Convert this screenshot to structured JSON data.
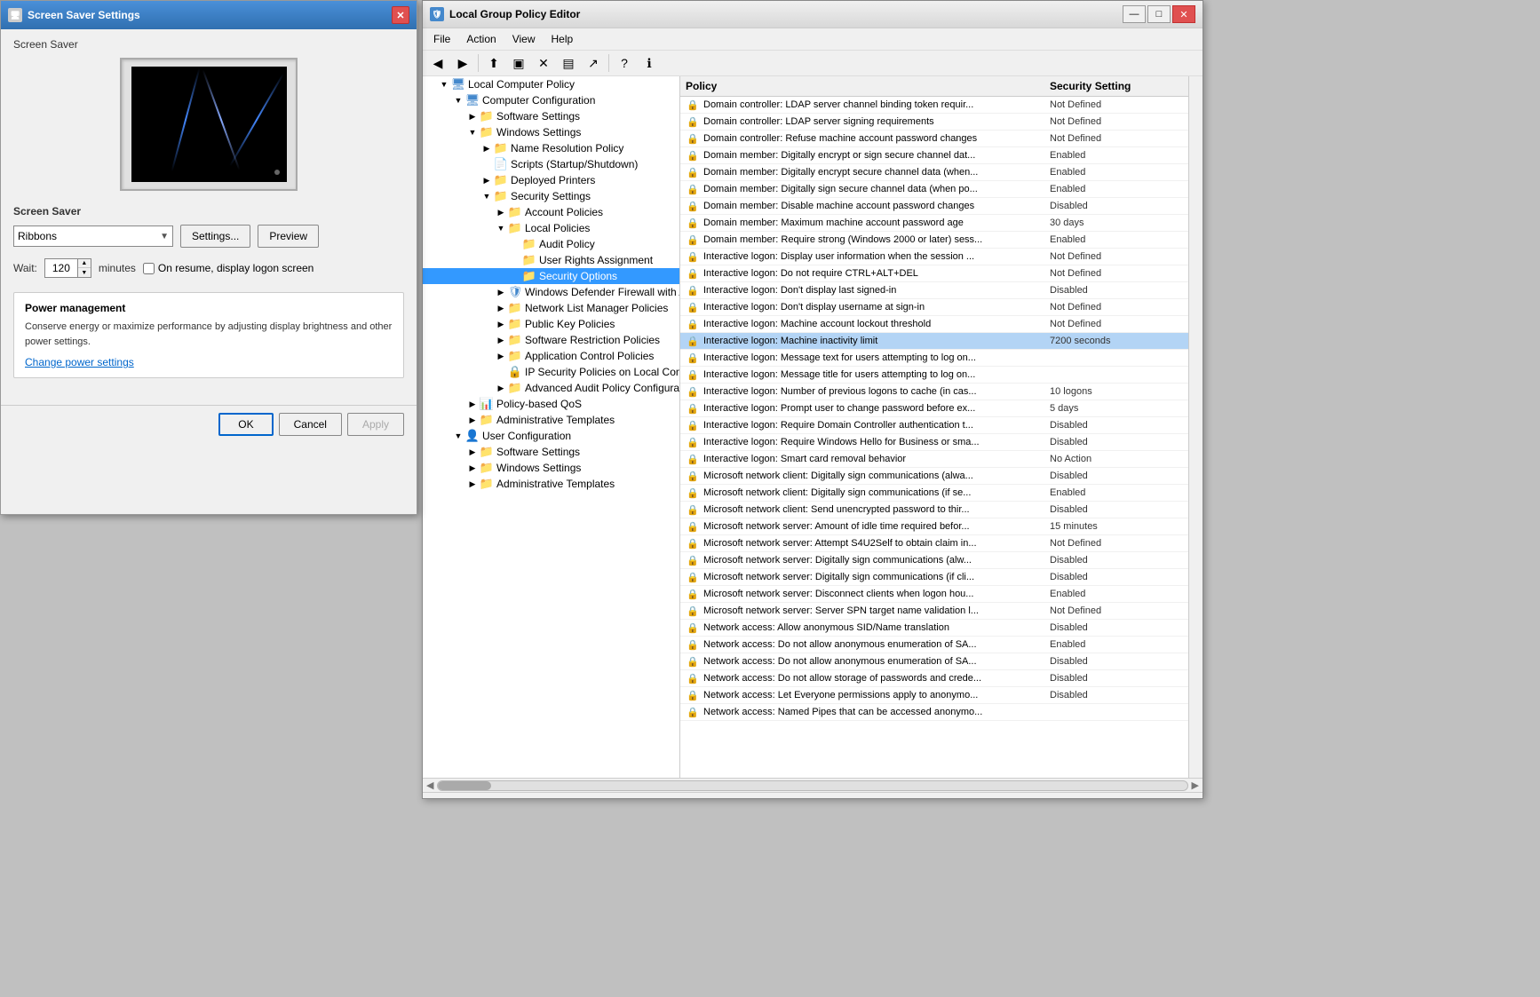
{
  "screensaver_dialog": {
    "title": "Screen Saver Settings",
    "section_label": "Screen Saver",
    "screensaver_name": "Ribbons",
    "settings_btn": "Settings...",
    "preview_btn": "Preview",
    "wait_label": "Wait:",
    "wait_value": "120",
    "minutes_label": "minutes",
    "resume_label": "On resume, display logon screen",
    "power_title": "Power management",
    "power_text": "Conserve energy or maximize performance by adjusting display brightness and other power settings.",
    "power_link": "Change power settings",
    "ok_btn": "OK",
    "cancel_btn": "Cancel",
    "apply_btn": "Apply"
  },
  "gpo_window": {
    "title": "Local Group Policy Editor",
    "menu": {
      "file": "File",
      "action": "Action",
      "view": "View",
      "help": "Help"
    },
    "tree": {
      "root": "Local Computer Policy",
      "computer_config": "Computer Configuration",
      "software_settings": "Software Settings",
      "windows_settings": "Windows Settings",
      "name_resolution": "Name Resolution Policy",
      "scripts": "Scripts (Startup/Shutdown)",
      "deployed_printers": "Deployed Printers",
      "security_settings": "Security Settings",
      "account_policies": "Account Policies",
      "local_policies": "Local Policies",
      "audit_policy": "Audit Policy",
      "user_rights": "User Rights Assignment",
      "security_options": "Security Options",
      "windows_firewall": "Windows Defender Firewall with Adv...",
      "network_list": "Network List Manager Policies",
      "public_key": "Public Key Policies",
      "software_restriction": "Software Restriction Policies",
      "app_control": "Application Control Policies",
      "ip_security": "IP Security Policies on Local Compute...",
      "advanced_audit": "Advanced Audit Policy Configuration",
      "policy_qos": "Policy-based QoS",
      "admin_templates_comp": "Administrative Templates",
      "user_config": "User Configuration",
      "software_settings_user": "Software Settings",
      "windows_settings_user": "Windows Settings",
      "admin_templates_user": "Administrative Templates"
    },
    "policy_header": {
      "policy": "Policy",
      "security_setting": "Security Setting"
    },
    "policies": [
      {
        "name": "Domain controller: LDAP server channel binding token requir...",
        "value": "Not Defined",
        "selected": false
      },
      {
        "name": "Domain controller: LDAP server signing requirements",
        "value": "Not Defined",
        "selected": false
      },
      {
        "name": "Domain controller: Refuse machine account password changes",
        "value": "Not Defined",
        "selected": false
      },
      {
        "name": "Domain member: Digitally encrypt or sign secure channel dat...",
        "value": "Enabled",
        "selected": false
      },
      {
        "name": "Domain member: Digitally encrypt secure channel data (when...",
        "value": "Enabled",
        "selected": false
      },
      {
        "name": "Domain member: Digitally sign secure channel data (when po...",
        "value": "Enabled",
        "selected": false
      },
      {
        "name": "Domain member: Disable machine account password changes",
        "value": "Disabled",
        "selected": false
      },
      {
        "name": "Domain member: Maximum machine account password age",
        "value": "30 days",
        "selected": false
      },
      {
        "name": "Domain member: Require strong (Windows 2000 or later) sess...",
        "value": "Enabled",
        "selected": false
      },
      {
        "name": "Interactive logon: Display user information when the session ...",
        "value": "Not Defined",
        "selected": false
      },
      {
        "name": "Interactive logon: Do not require CTRL+ALT+DEL",
        "value": "Not Defined",
        "selected": false
      },
      {
        "name": "Interactive logon: Don't display last signed-in",
        "value": "Disabled",
        "selected": false
      },
      {
        "name": "Interactive logon: Don't display username at sign-in",
        "value": "Not Defined",
        "selected": false
      },
      {
        "name": "Interactive logon: Machine account lockout threshold",
        "value": "Not Defined",
        "selected": false
      },
      {
        "name": "Interactive logon: Machine inactivity limit",
        "value": "7200 seconds",
        "selected": true
      },
      {
        "name": "Interactive logon: Message text for users attempting to log on...",
        "value": "",
        "selected": false
      },
      {
        "name": "Interactive logon: Message title for users attempting to log on...",
        "value": "",
        "selected": false
      },
      {
        "name": "Interactive logon: Number of previous logons to cache (in cas...",
        "value": "10 logons",
        "selected": false
      },
      {
        "name": "Interactive logon: Prompt user to change password before ex...",
        "value": "5 days",
        "selected": false
      },
      {
        "name": "Interactive logon: Require Domain Controller authentication t...",
        "value": "Disabled",
        "selected": false
      },
      {
        "name": "Interactive logon: Require Windows Hello for Business or sma...",
        "value": "Disabled",
        "selected": false
      },
      {
        "name": "Interactive logon: Smart card removal behavior",
        "value": "No Action",
        "selected": false
      },
      {
        "name": "Microsoft network client: Digitally sign communications (alwa...",
        "value": "Disabled",
        "selected": false
      },
      {
        "name": "Microsoft network client: Digitally sign communications (if se...",
        "value": "Enabled",
        "selected": false
      },
      {
        "name": "Microsoft network client: Send unencrypted password to thir...",
        "value": "Disabled",
        "selected": false
      },
      {
        "name": "Microsoft network server: Amount of idle time required befor...",
        "value": "15 minutes",
        "selected": false
      },
      {
        "name": "Microsoft network server: Attempt S4U2Self to obtain claim in...",
        "value": "Not Defined",
        "selected": false
      },
      {
        "name": "Microsoft network server: Digitally sign communications (alw...",
        "value": "Disabled",
        "selected": false
      },
      {
        "name": "Microsoft network server: Digitally sign communications (if cli...",
        "value": "Disabled",
        "selected": false
      },
      {
        "name": "Microsoft network server: Disconnect clients when logon hou...",
        "value": "Enabled",
        "selected": false
      },
      {
        "name": "Microsoft network server: Server SPN target name validation l...",
        "value": "Not Defined",
        "selected": false
      },
      {
        "name": "Network access: Allow anonymous SID/Name translation",
        "value": "Disabled",
        "selected": false
      },
      {
        "name": "Network access: Do not allow anonymous enumeration of SA...",
        "value": "Enabled",
        "selected": false
      },
      {
        "name": "Network access: Do not allow anonymous enumeration of SA...",
        "value": "Disabled",
        "selected": false
      },
      {
        "name": "Network access: Do not allow storage of passwords and crede...",
        "value": "Disabled",
        "selected": false
      },
      {
        "name": "Network access: Let Everyone permissions apply to anonymo...",
        "value": "Disabled",
        "selected": false
      },
      {
        "name": "Network access: Named Pipes that can be accessed anonymo...",
        "value": "",
        "selected": false
      }
    ]
  }
}
